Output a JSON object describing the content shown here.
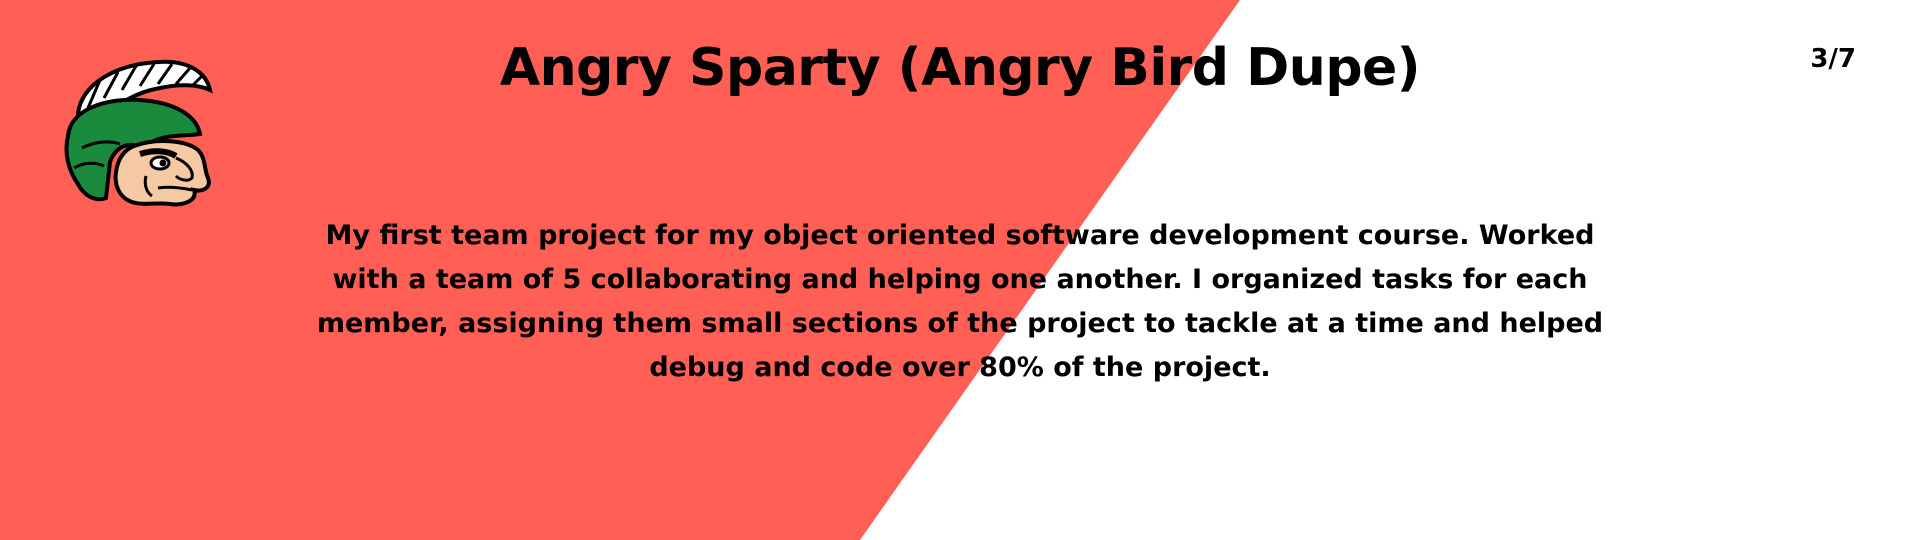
{
  "slide": {
    "title": "Angry Sparty (Angry Bird Dupe)",
    "page_counter": "3/7",
    "description": "My first team project for my object oriented software development course. Worked with a team of 5 collaborating and helping one another. I organized tasks for each member, assigning them small sections  of the project to tackle at a time and helped debug and code over 80% of the project."
  },
  "colors": {
    "accent": "#FF5F55",
    "background": "#FFFFFF",
    "text": "#000000"
  },
  "icons": {
    "logo": "spartan-helmet-mascot-icon"
  }
}
